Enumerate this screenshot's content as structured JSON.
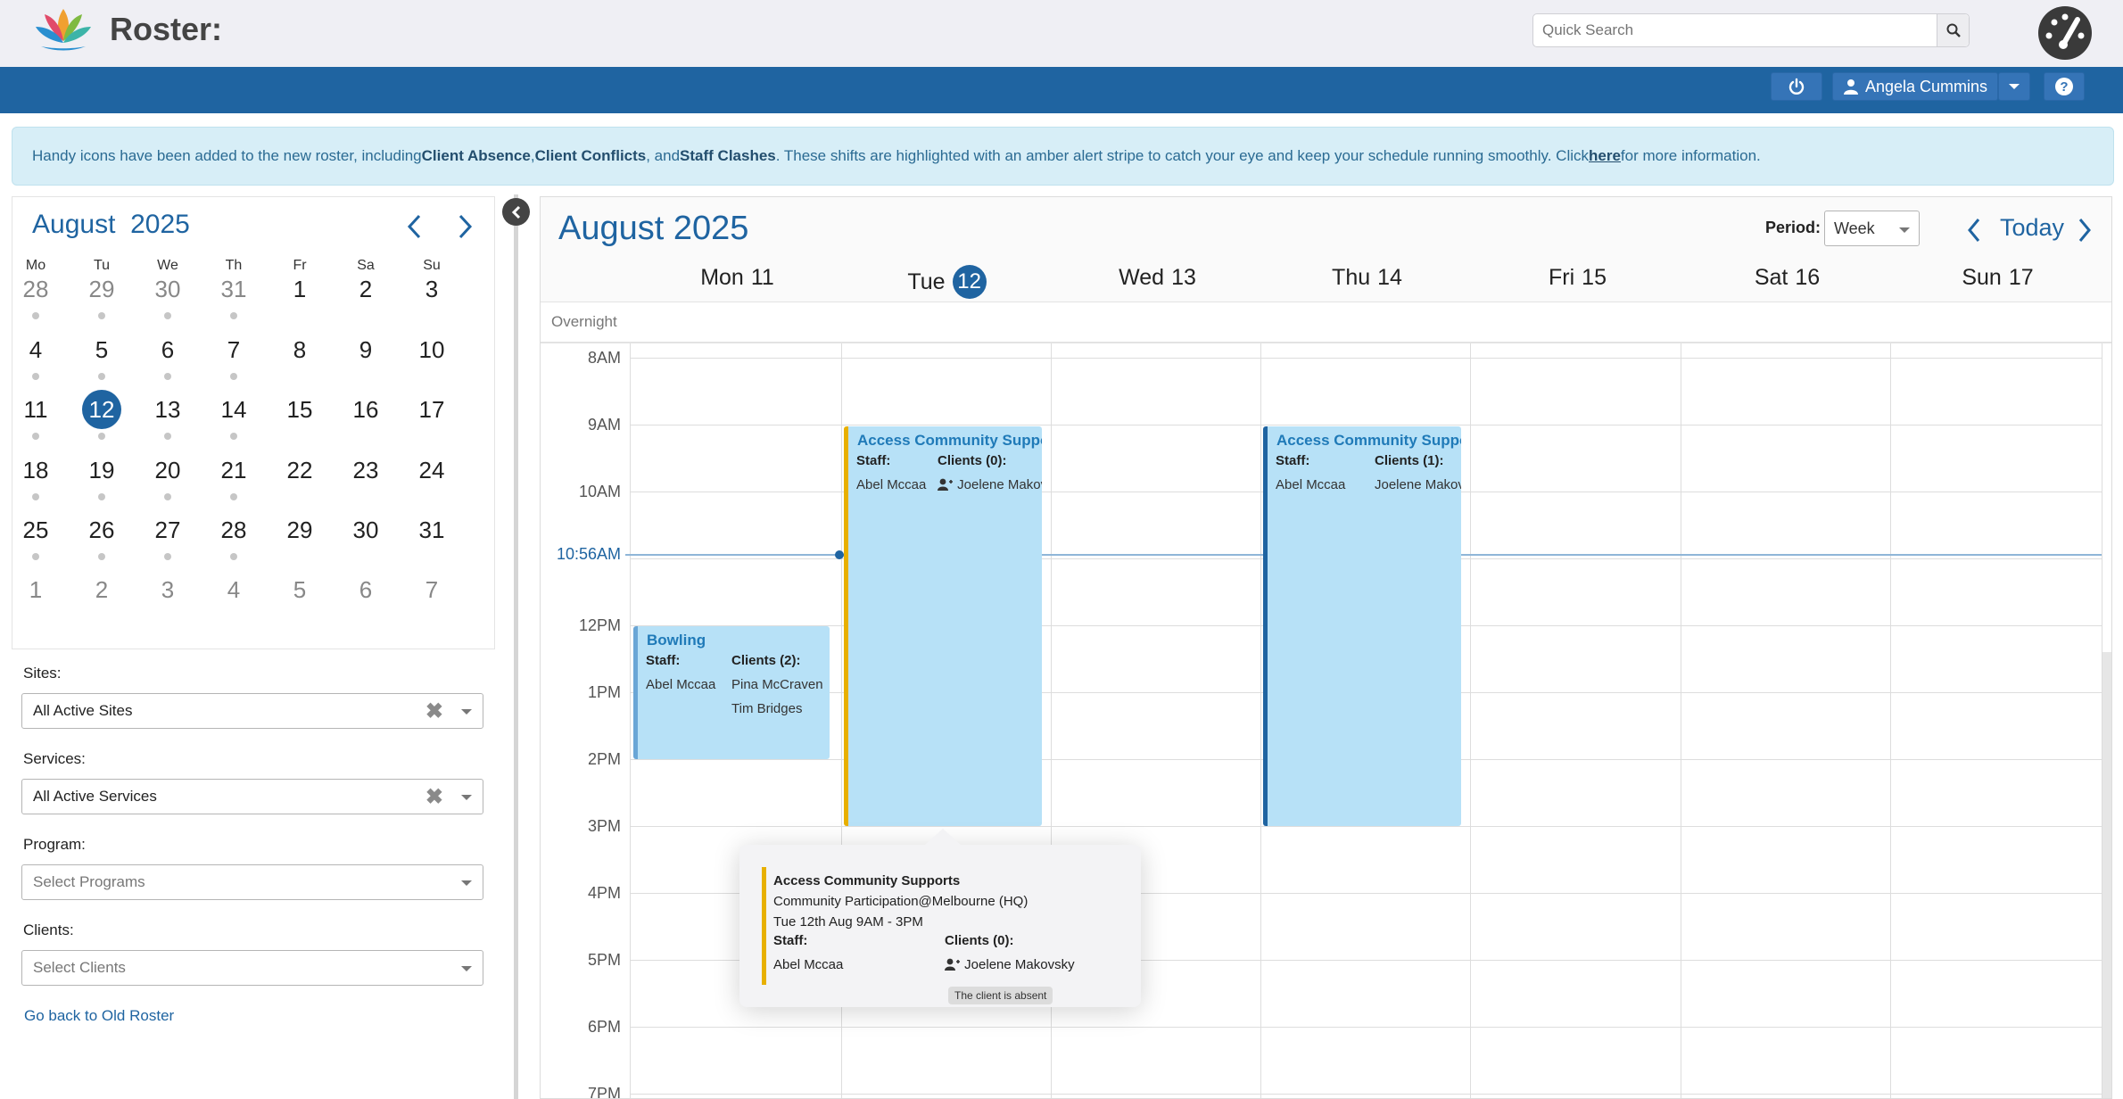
{
  "app": {
    "title": "Roster:"
  },
  "search": {
    "placeholder": "Quick Search"
  },
  "user": {
    "name": "Angela Cummins"
  },
  "alert": {
    "p1": "Handy icons have been added to the new roster, including ",
    "b1": "Client Absence",
    "p2": ", ",
    "b2": "Client Conflicts",
    "p3": ", and ",
    "b3": "Staff Clashes",
    "p4": ". These shifts are highlighted with an amber alert stripe to catch your eye and keep your schedule running smoothly. Click ",
    "link": "here",
    "p5": " for more information."
  },
  "minical": {
    "month": "August",
    "year": "2025",
    "dow": [
      "Mo",
      "Tu",
      "We",
      "Th",
      "Fr",
      "Sa",
      "Su"
    ],
    "weeks": [
      [
        "28",
        "29",
        "30",
        "31",
        "1",
        "2",
        "3"
      ],
      [
        "4",
        "5",
        "6",
        "7",
        "8",
        "9",
        "10"
      ],
      [
        "11",
        "12",
        "13",
        "14",
        "15",
        "16",
        "17"
      ],
      [
        "18",
        "19",
        "20",
        "21",
        "22",
        "23",
        "24"
      ],
      [
        "25",
        "26",
        "27",
        "28",
        "29",
        "30",
        "31"
      ],
      [
        "1",
        "2",
        "3",
        "4",
        "5",
        "6",
        "7"
      ]
    ],
    "selected": "12"
  },
  "filters": {
    "sites_label": "Sites:",
    "sites_value": "All Active Sites",
    "services_label": "Services:",
    "services_value": "All Active Services",
    "program_label": "Program:",
    "program_placeholder": "Select Programs",
    "clients_label": "Clients:",
    "clients_placeholder": "Select Clients"
  },
  "old_roster_link": "Go back to Old Roster",
  "calendar": {
    "title": "August 2025",
    "period_label": "Period:",
    "period_value": "Week",
    "today_label": "Today",
    "overnight_label": "Overnight",
    "days": [
      {
        "name": "Mon",
        "num": "11"
      },
      {
        "name": "Tue",
        "num": "12"
      },
      {
        "name": "Wed",
        "num": "13"
      },
      {
        "name": "Thu",
        "num": "14"
      },
      {
        "name": "Fri",
        "num": "15"
      },
      {
        "name": "Sat",
        "num": "16"
      },
      {
        "name": "Sun",
        "num": "17"
      }
    ],
    "times": [
      "8AM",
      "9AM",
      "10AM",
      "12PM",
      "1PM",
      "2PM",
      "3PM",
      "4PM",
      "5PM",
      "6PM",
      "7PM"
    ],
    "now_label": "10:56AM"
  },
  "events": {
    "bowling": {
      "title": "Bowling",
      "staff_label": "Staff:",
      "staff": "Abel Mccaa",
      "clients_label": "Clients (2):",
      "client1": "Pina McCraven",
      "client2": "Tim Bridges",
      "color": "#6aa6d6"
    },
    "tue": {
      "title": "Access Community Supports",
      "staff_label": "Staff:",
      "staff": "Abel Mccaa",
      "clients_label": "Clients (0):",
      "client1": "Joelene Makovsky",
      "color": "#e8b000"
    },
    "thu": {
      "title": "Access Community Supports",
      "staff_label": "Staff:",
      "staff": "Abel Mccaa",
      "clients_label": "Clients (1):",
      "client1": "Joelene Makovsky",
      "color": "#1f64a1"
    }
  },
  "popup": {
    "title": "Access Community Supports",
    "location": "Community Participation@Melbourne (HQ)",
    "time": "Tue 12th Aug 9AM - 3PM",
    "staff_label": "Staff:",
    "staff": "Abel Mccaa",
    "clients_label": "Clients (0):",
    "client": "Joelene Makovsky",
    "tooltip": "The client is absent"
  },
  "icons": [
    "lotus-logo",
    "search-icon",
    "dashboard-gauge-icon",
    "power-icon",
    "user-icon",
    "caret-down-icon",
    "help-icon",
    "chevron-left-icon",
    "chevron-right-icon",
    "clear-x-icon",
    "client-absent-icon"
  ]
}
